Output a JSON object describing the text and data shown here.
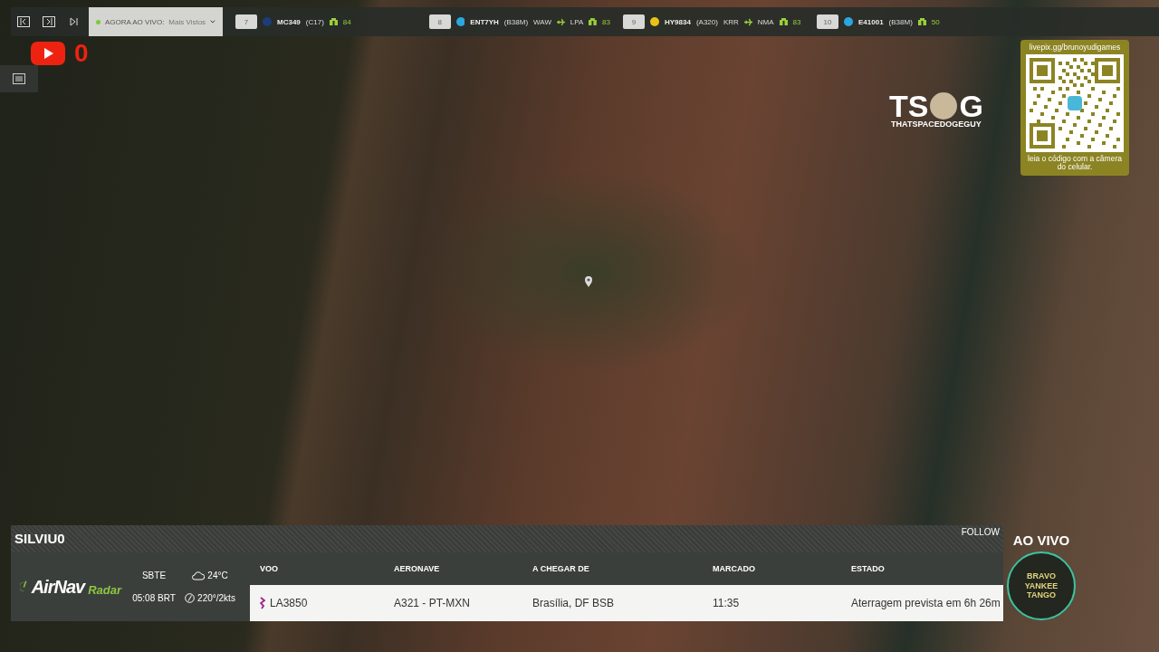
{
  "top_bar": {
    "nav_buttons": [
      {
        "kind": "first"
      },
      {
        "kind": "window"
      },
      {
        "kind": "next"
      }
    ],
    "dropdown": {
      "live": true,
      "label": "AGORA AO VIVO:",
      "value": "Mais Vistos"
    },
    "slots": [
      {
        "number": "7",
        "color": "#1c3d7a",
        "callsign": "MC349",
        "type": "(C17)",
        "signal": "84"
      },
      {
        "number": "8",
        "color": "#2aa7e0",
        "callsign": "ENT7YH",
        "type": "(B38M)",
        "from": "WAW",
        "to": "LPA",
        "signal": "83"
      },
      {
        "number": "9",
        "color": "#e8c21a",
        "callsign": "HY9834",
        "type": "(A320)",
        "from": "KRR",
        "to": "NMA",
        "signal": "83"
      },
      {
        "number": "10",
        "color": "#2aa7e0",
        "callsign": "E41001",
        "type": "(B38M)",
        "signal": "50"
      }
    ]
  },
  "youtube_count": "0",
  "logo": {
    "left": "TS",
    "right": "G",
    "subtitle": "THATSPACEDOGEGUY"
  },
  "qr_card": {
    "url": "livepix.gg/brunoyudigames",
    "caption": "leia o código com a câmera do celular."
  },
  "flight_panel": {
    "name": "SILVIU0",
    "follow": "FOLLOW",
    "brand": {
      "main": "AirNav",
      "sub": "Radar"
    },
    "airport": "SBTE",
    "time": "05:08 BRT",
    "temperature": "24°C",
    "wind": "220°/2kts",
    "columns": [
      "VOO",
      "AERONAVE",
      "A CHEGAR DE",
      "MARCADO",
      "ESTADO"
    ],
    "row": [
      "LA3850",
      "A321 - PT-MXN",
      "Brasília, DF BSB",
      "11:35",
      "Aterragem prevista em 6h 26m"
    ]
  },
  "live_badge": {
    "label": "AO VIVO",
    "emblem_text": "BRAVO YANKEE TANGO"
  }
}
